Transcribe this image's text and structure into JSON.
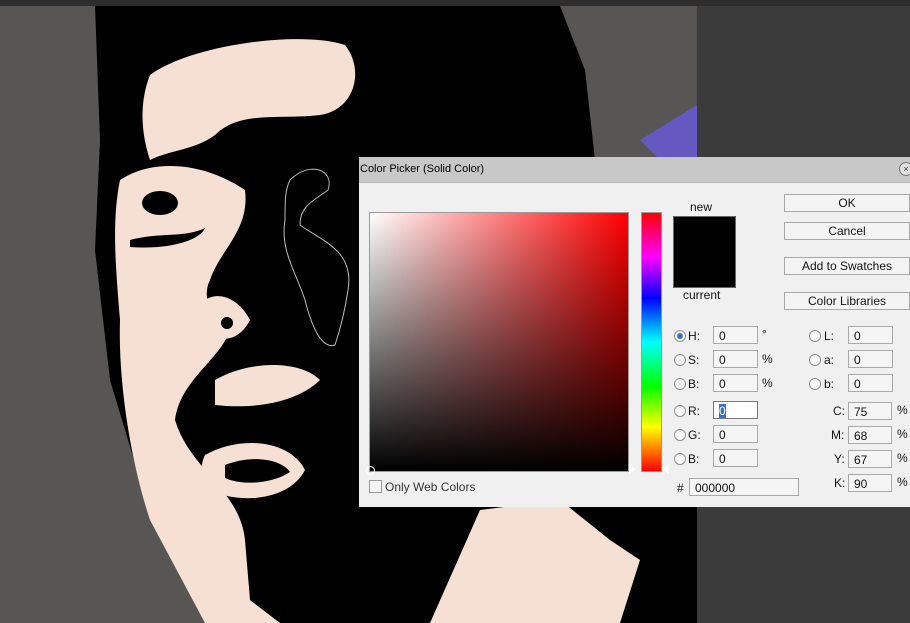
{
  "dialog": {
    "title": "Color Picker (Solid Color)",
    "close_symbol": "×",
    "new_label": "new",
    "current_label": "current",
    "new_color": "#000000",
    "current_color": "#000000"
  },
  "buttons": {
    "ok": "OK",
    "cancel": "Cancel",
    "add_to_swatches": "Add to Swatches",
    "color_libraries": "Color Libraries"
  },
  "hsb": {
    "h_label": "H:",
    "h_value": "0",
    "h_unit": "°",
    "s_label": "S:",
    "s_value": "0",
    "s_unit": "%",
    "b_label": "B:",
    "b_value": "0",
    "b_unit": "%",
    "selected": "H"
  },
  "rgb": {
    "r_label": "R:",
    "r_value": "0",
    "g_label": "G:",
    "g_value": "0",
    "b_label": "B:",
    "b_value": "0"
  },
  "lab": {
    "l_label": "L:",
    "l_value": "0",
    "a_label": "a:",
    "a_value": "0",
    "b_label": "b:",
    "b_value": "0"
  },
  "cmyk": {
    "c_label": "C:",
    "c_value": "75",
    "c_unit": "%",
    "m_label": "M:",
    "m_value": "68",
    "m_unit": "%",
    "y_label": "Y:",
    "y_value": "67",
    "y_unit": "%",
    "k_label": "K:",
    "k_value": "90",
    "k_unit": "%"
  },
  "hex": {
    "label": "#",
    "value": "000000"
  },
  "web_colors": {
    "label": "Only Web Colors",
    "checked": false
  },
  "colors": {
    "skin": "#f6e0d3",
    "background_gray": "#575655",
    "accent_purple": "#6558c0",
    "accent_teal": "#57a5ae"
  }
}
